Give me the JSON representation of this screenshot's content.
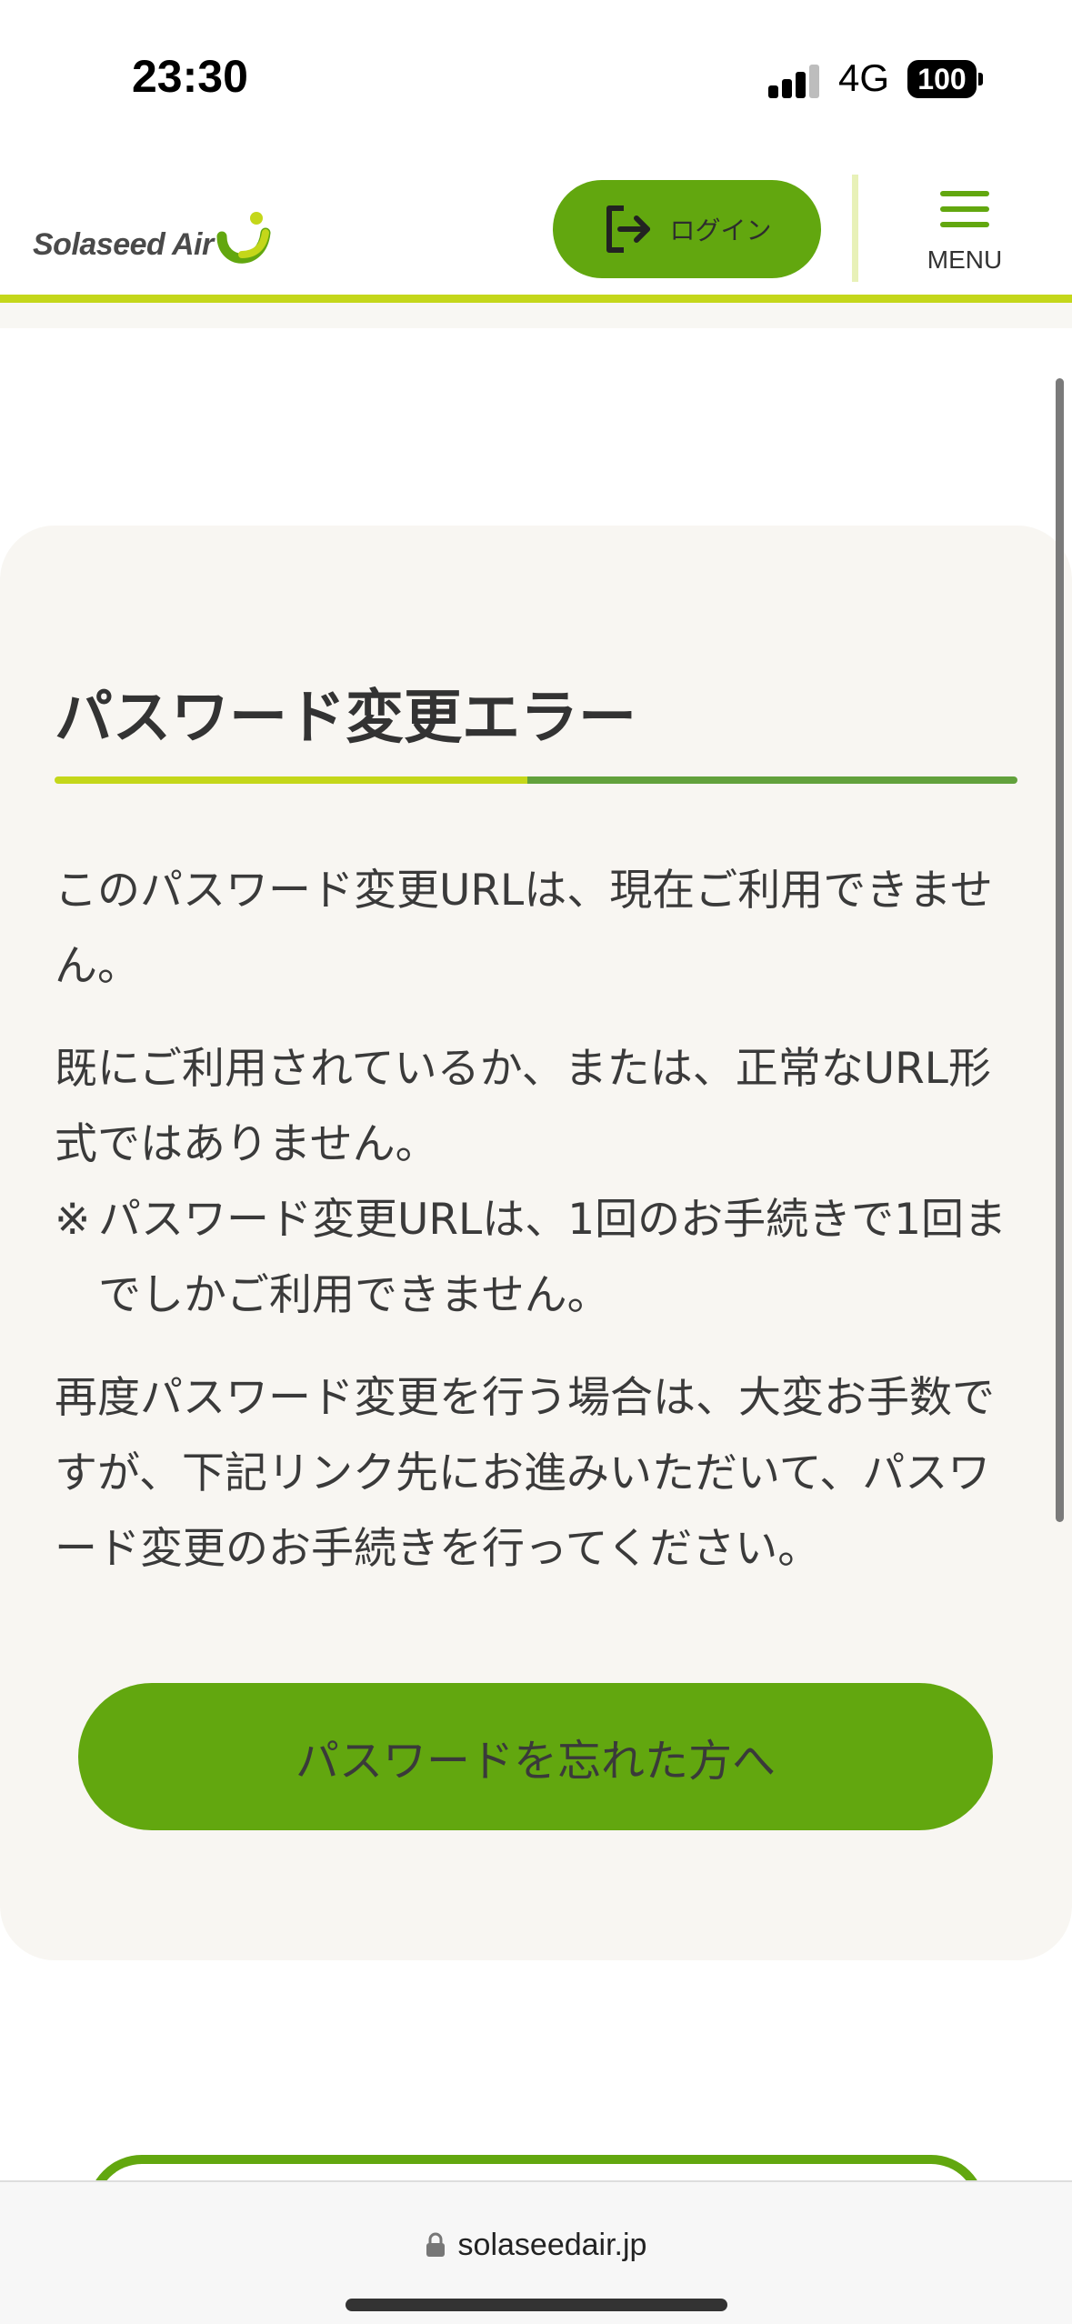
{
  "status_bar": {
    "time": "23:30",
    "network": "4G",
    "battery": "100"
  },
  "header": {
    "logo_text": "Solaseed Air",
    "login_label": "ログイン",
    "menu_label": "MENU",
    "accent_color": "#62a70f",
    "line_color": "#c4d71a"
  },
  "main": {
    "title": "パスワード変更エラー",
    "paragraph1": "このパスワード変更URLは、現在ご利用できません。",
    "paragraph2": "既にご利用されているか、または、正常なURL形式ではありません。",
    "note_mark": "※",
    "note_text": "パスワード変更URLは、1回のお手続きで1回までしかご利用できません。",
    "paragraph3": "再度パスワード変更を行う場合は、大変お手数ですが、下記リンク先にお進みいただいて、パスワード変更のお手続きを行ってください。",
    "forgot_button": "パスワードを忘れた方へ"
  },
  "browser": {
    "url": "solaseedair.jp"
  }
}
